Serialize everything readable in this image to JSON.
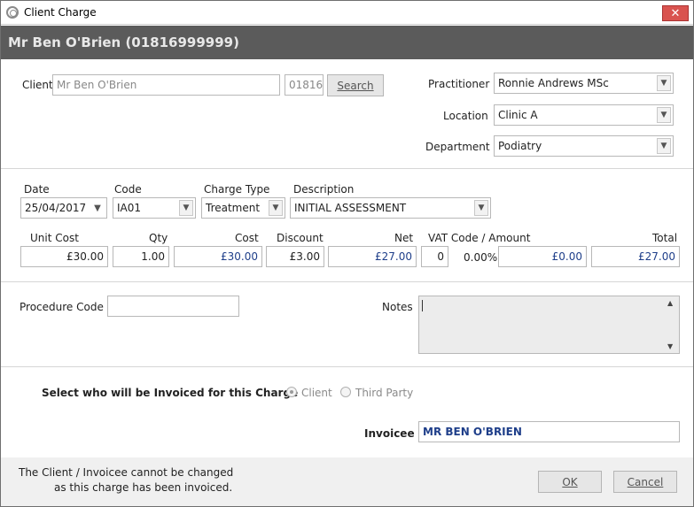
{
  "window": {
    "title": "Client Charge",
    "close_glyph": "✕"
  },
  "banner": {
    "text": "Mr Ben O'Brien (01816999999)"
  },
  "client": {
    "label": "Client",
    "name_value": "Mr Ben O'Brien",
    "code_value": "01816",
    "search_label": "Search"
  },
  "practitioner": {
    "label": "Practitioner",
    "value": "Ronnie Andrews MSc"
  },
  "location": {
    "label": "Location",
    "value": "Clinic A"
  },
  "department": {
    "label": "Department",
    "value": "Podiatry"
  },
  "charge": {
    "date_label": "Date",
    "date_value": "25/04/2017",
    "code_label": "Code",
    "code_value": "IA01",
    "charge_type_label": "Charge Type",
    "charge_type_value": "Treatment",
    "description_label": "Description",
    "description_value": "INITIAL ASSESSMENT",
    "unit_cost_label": "Unit Cost",
    "unit_cost_value": "£30.00",
    "qty_label": "Qty",
    "qty_value": "1.00",
    "cost_label": "Cost",
    "cost_value": "£30.00",
    "discount_label": "Discount",
    "discount_value": "£3.00",
    "net_label": "Net",
    "net_value": "£27.00",
    "vat_label": "VAT Code / Amount",
    "vat_code_value": "0",
    "vat_rate": "0.00%",
    "vat_amount_value": "£0.00",
    "total_label": "Total",
    "total_value": "£27.00"
  },
  "procedure": {
    "label": "Procedure Code",
    "value": ""
  },
  "notes": {
    "label": "Notes",
    "value": ""
  },
  "invoice": {
    "question": "Select who will be Invoiced for this Charge",
    "option_client": "Client",
    "option_third_party": "Third Party",
    "selected": "Client",
    "invoicee_label": "Invoicee",
    "invoicee_value": "MR BEN O'BRIEN"
  },
  "footer": {
    "message_line1": "The Client / Invoicee cannot be changed",
    "message_line2": "as this charge has been invoiced.",
    "ok_label": "OK",
    "cancel_label": "Cancel"
  },
  "colors": {
    "banner": "#5b5b5b",
    "accent_text": "#1f3f8a",
    "close": "#d9534f"
  }
}
